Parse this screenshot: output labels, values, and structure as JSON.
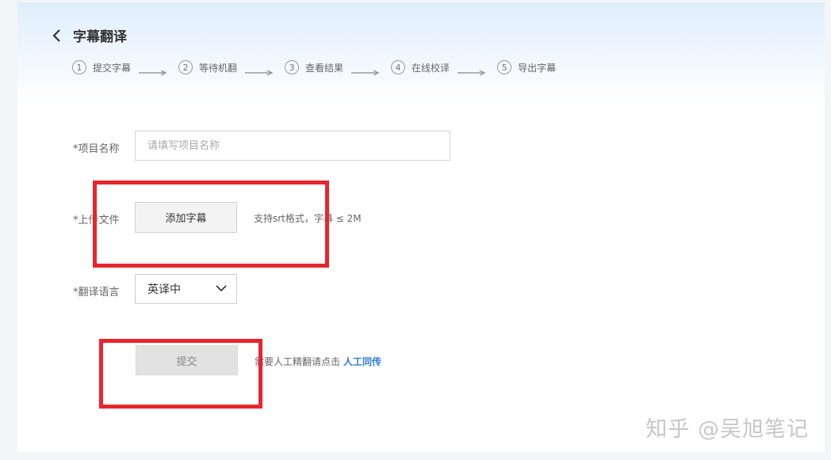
{
  "header": {
    "back_icon": "chevron-left-icon",
    "title": "字幕翻译"
  },
  "steps": [
    {
      "num": "1",
      "label": "提交字幕"
    },
    {
      "num": "2",
      "label": "等待机翻"
    },
    {
      "num": "3",
      "label": "查看结果"
    },
    {
      "num": "4",
      "label": "在线校译"
    },
    {
      "num": "5",
      "label": "导出字幕"
    }
  ],
  "form": {
    "project_name": {
      "label": "*项目名称",
      "value": "",
      "placeholder": "请填写项目名称"
    },
    "upload": {
      "label": "*上传文件",
      "button_label": "添加字幕",
      "hint": "支持srt格式，字幕 ≤ 2M"
    },
    "language": {
      "label": "*翻译语言",
      "selected": "英译中",
      "icon": "chevron-down-icon"
    },
    "submit": {
      "button_label": "提交",
      "hint_prefix": "需要人工精翻请点击",
      "link_label": "人工同传"
    }
  },
  "annotations": {
    "highlight_color": "#e8252f"
  },
  "watermark": "知乎 @吴旭笔记",
  "colors": {
    "accent_link": "#2f7fd6",
    "header_gradient_top": "#dfeefc"
  }
}
